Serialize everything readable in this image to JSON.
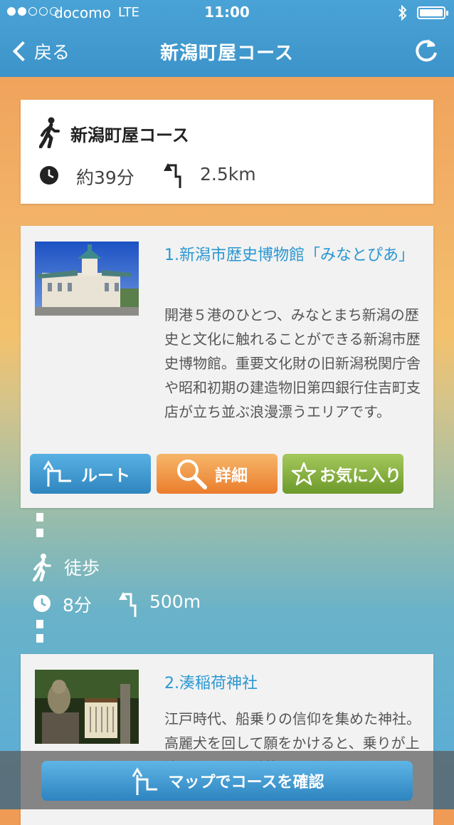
{
  "status_bar": {
    "carrier": "docomo",
    "network": "LTE",
    "time": "11:00"
  },
  "nav": {
    "back_label": "戻る",
    "title": "新潟町屋コース"
  },
  "course": {
    "name": "新潟町屋コース",
    "time": "約39分",
    "distance": "2.5km"
  },
  "spots": [
    {
      "title": "1.新潟市歴史博物館「みなとぴあ」",
      "description": "開港５港のひとつ、みなとまち新潟の歴史と文化に触れることができる新潟市歴史博物館。重要文化財の旧新潟税関庁舎や昭和初期の建造物旧第四銀行住吉町支店が立ち並ぶ浪漫漂うエリアです。"
    },
    {
      "title": "2.湊稲荷神社",
      "description": "江戸時代、船乗りの信仰を集めた神社。高麗犬を回して願をかけると、乗りが上流みなとも、稲荷とも呼ばれました。"
    }
  ],
  "buttons": {
    "route": "ルート",
    "detail": "詳細",
    "favorite": "お気に入り"
  },
  "leg": {
    "mode": "徒歩",
    "time": "8分",
    "distance": "500m"
  },
  "bottom": {
    "map_button": "マップでコースを確認"
  },
  "colors": {
    "nav": "#3c93c9",
    "spot_title": "#2a97d2",
    "route_btn": "#2f86bf",
    "detail_btn": "#ea7d2c",
    "favorite_btn": "#6d9a2a"
  }
}
